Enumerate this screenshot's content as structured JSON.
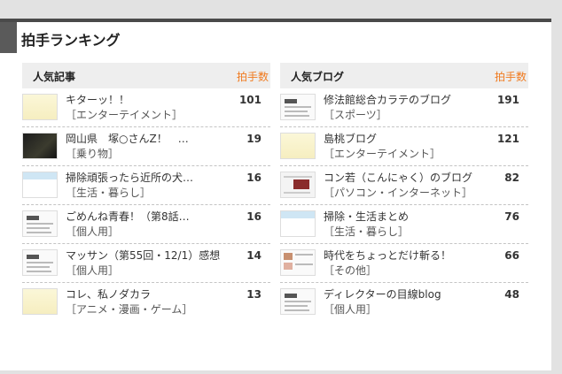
{
  "header": {
    "title": "拍手ランキング"
  },
  "popular_articles": {
    "heading": "人気記事",
    "count_label": "拍手数",
    "items": [
      {
        "title": "キターッ！！",
        "category": "［エンターテイメント］",
        "count": "101",
        "thumb": "yellow"
      },
      {
        "title": "岡山県　塚○さんZ！　…",
        "category": "［乗り物］",
        "count": "19",
        "thumb": "dark"
      },
      {
        "title": "掃除頑張ったら近所の犬…",
        "category": "［生活・暮らし］",
        "count": "16",
        "thumb": "light"
      },
      {
        "title": "ごめんね青春！（第8話…",
        "category": "［個人用］",
        "count": "16",
        "thumb": "page"
      },
      {
        "title": "マッサン（第55回・12/1）感想",
        "category": "［個人用］",
        "count": "14",
        "thumb": "page"
      },
      {
        "title": "コレ、私ノダカラ",
        "category": "［アニメ・漫画・ゲーム］",
        "count": "13",
        "thumb": "yellow"
      }
    ]
  },
  "popular_blogs": {
    "heading": "人気ブログ",
    "count_label": "拍手数",
    "items": [
      {
        "title": "修法館総合カラテのブログ",
        "category": "［スポーツ］",
        "count": "191",
        "thumb": "page"
      },
      {
        "title": "島桃ブログ",
        "category": "［エンターテイメント］",
        "count": "121",
        "thumb": "yellow"
      },
      {
        "title": "コン若（こんにゃく）のブログ",
        "category": "［パソコン・インターネット］",
        "count": "82",
        "thumb": "pagecol"
      },
      {
        "title": "掃除・生活まとめ",
        "category": "［生活・暮らし］",
        "count": "76",
        "thumb": "light"
      },
      {
        "title": "時代をちょっとだけ斬る！",
        "category": "［その他］",
        "count": "66",
        "thumb": "multi"
      },
      {
        "title": "ディレクターの目線blog",
        "category": "［個人用］",
        "count": "48",
        "thumb": "page"
      }
    ]
  }
}
